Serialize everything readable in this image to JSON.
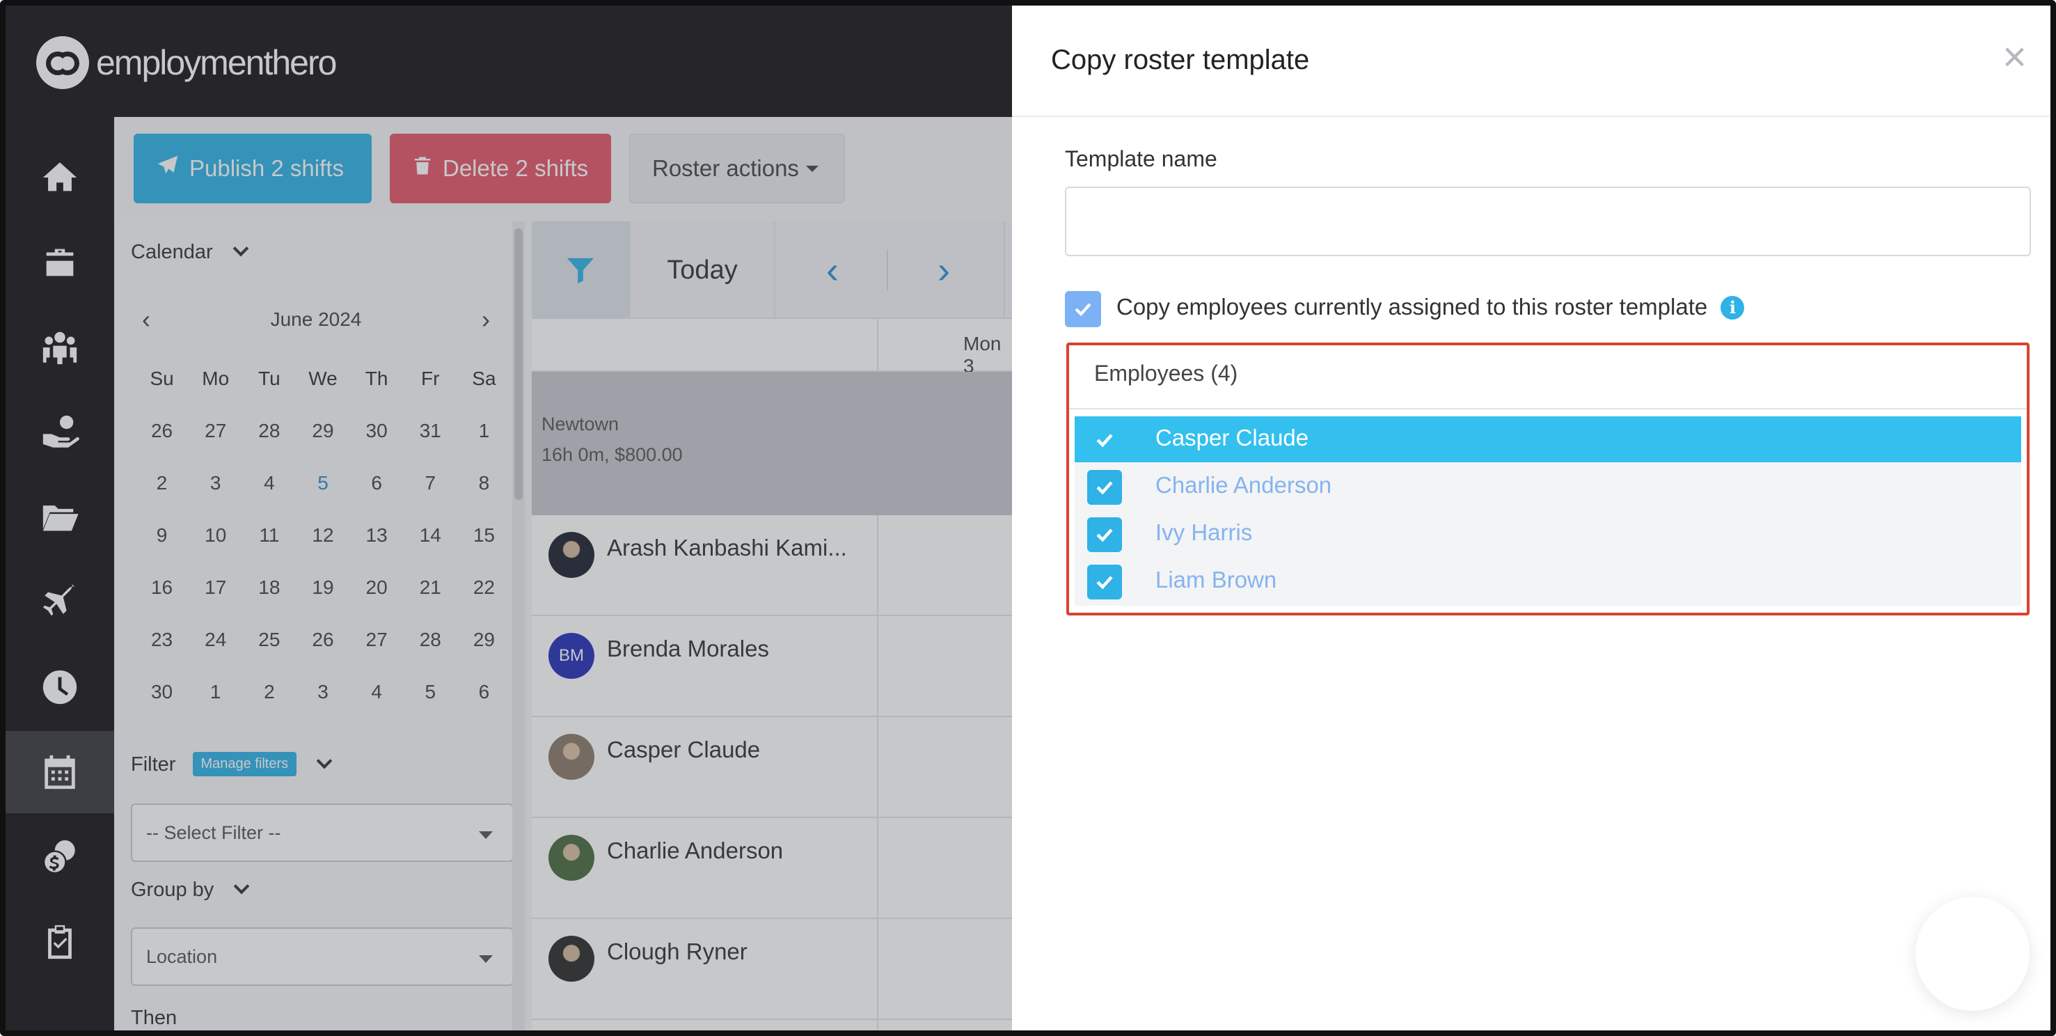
{
  "brand": {
    "name": "employmenthero"
  },
  "toolbar": {
    "publish_label": "Publish 2 shifts",
    "delete_label": "Delete 2 shifts",
    "roster_actions_label": "Roster actions"
  },
  "sidenav": {
    "items": [
      {
        "icon": "home-icon"
      },
      {
        "icon": "briefcase-icon"
      },
      {
        "icon": "people-icon"
      },
      {
        "icon": "hand-money-icon"
      },
      {
        "icon": "folder-icon"
      },
      {
        "icon": "airplane-icon"
      },
      {
        "icon": "clock-icon"
      },
      {
        "icon": "calendar-icon",
        "active": true
      },
      {
        "icon": "coins-icon"
      },
      {
        "icon": "clipboard-check-icon"
      }
    ]
  },
  "calendar": {
    "section_label": "Calendar",
    "month_label": "June 2024",
    "weekdays": [
      "Su",
      "Mo",
      "Tu",
      "We",
      "Th",
      "Fr",
      "Sa"
    ],
    "weeks": [
      [
        "26",
        "27",
        "28",
        "29",
        "30",
        "31",
        "1"
      ],
      [
        "2",
        "3",
        "4",
        "5",
        "6",
        "7",
        "8"
      ],
      [
        "9",
        "10",
        "11",
        "12",
        "13",
        "14",
        "15"
      ],
      [
        "16",
        "17",
        "18",
        "19",
        "20",
        "21",
        "22"
      ],
      [
        "23",
        "24",
        "25",
        "26",
        "27",
        "28",
        "29"
      ],
      [
        "30",
        "1",
        "2",
        "3",
        "4",
        "5",
        "6"
      ]
    ],
    "today": "5"
  },
  "filter": {
    "label": "Filter",
    "manage_label": "Manage filters",
    "select_placeholder": "-- Select Filter --"
  },
  "group_by": {
    "label": "Group by",
    "value": "Location"
  },
  "then_label": "Then",
  "grid": {
    "today_label": "Today",
    "day_header": "Mon 3",
    "location": {
      "name": "Newtown",
      "summary": "16h 0m, $800.00"
    },
    "employees": [
      {
        "name": "Arash Kanbashi Kami...",
        "avatar": "photo",
        "color": "#1f2333"
      },
      {
        "name": "Brenda Morales",
        "avatar": "BM",
        "color": "#2631b8"
      },
      {
        "name": "Casper Claude",
        "avatar": "photo",
        "color": "#8a7a6a"
      },
      {
        "name": "Charlie Anderson",
        "avatar": "photo",
        "color": "#4a6a3e"
      },
      {
        "name": "Clough Ryner",
        "avatar": "photo",
        "color": "#2b2b2b"
      }
    ]
  },
  "modal": {
    "title": "Copy roster template",
    "template_name_label": "Template name",
    "template_name_value": "",
    "copy_employees_label": "Copy employees currently assigned to this roster template",
    "copy_employees_checked": true,
    "employees_header": "Employees (4)",
    "employees": [
      {
        "name": "Casper Claude",
        "checked": true,
        "highlighted": true
      },
      {
        "name": "Charlie Anderson",
        "checked": true,
        "highlighted": false
      },
      {
        "name": "Ivy Harris",
        "checked": true,
        "highlighted": false
      },
      {
        "name": "Liam Brown",
        "checked": true,
        "highlighted": false
      }
    ]
  },
  "colors": {
    "accent": "#2fb2e6",
    "danger": "#e4566b",
    "highlight_border": "#d9432f",
    "nav_bg": "#17161a"
  }
}
